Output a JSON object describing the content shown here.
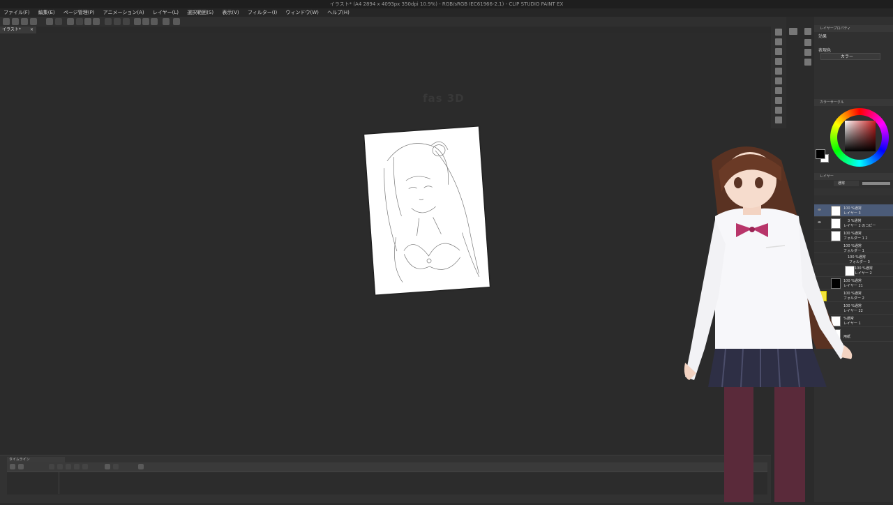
{
  "window": {
    "title": "イラスト* (A4 2894 x 4093px 350dpi 10.9%) - RGB/sRGB IEC61966-2.1) - CLIP STUDIO PAINT EX"
  },
  "menu": [
    "ファイル(F)",
    "編集(E)",
    "ページ管理(P)",
    "アニメーション(A)",
    "レイヤー(L)",
    "選択範囲(S)",
    "表示(V)",
    "フィルター(I)",
    "ウィンドウ(W)",
    "ヘルプ(H)"
  ],
  "document_tab": {
    "label": "イラスト*",
    "close": "×"
  },
  "canvas": {
    "ghost_text": "fas 3D"
  },
  "timeline": {
    "title": "タイムライン"
  },
  "panels": {
    "effects_header": "レイヤープロパティ",
    "effect_label": "効果",
    "expression_color_label": "表現色",
    "expression_color_value": "カラー",
    "color_wheel_header": "カラーサークル",
    "layers_header": "レイヤー",
    "blend_mode": "通常"
  },
  "layers": [
    {
      "mode": "100 %通常",
      "name": "レイヤー 3",
      "selected": true
    },
    {
      "mode": "3 %通常",
      "name": "レイヤー 2 のコピー",
      "selected": false
    },
    {
      "mode": "100 %通常",
      "name": "フォルダー 1 2",
      "selected": false
    },
    {
      "mode": "100 %通常",
      "name": "フォルダー 1",
      "selected": false
    },
    {
      "mode": "100 %通常",
      "name": "フォルダー 3",
      "selected": false
    },
    {
      "mode": "100 %通常",
      "name": "レイヤー 2",
      "selected": false
    },
    {
      "mode": "100 %通常",
      "name": "レイヤー 21",
      "selected": false
    },
    {
      "mode": "100 %通常",
      "name": "フォルダー 2",
      "selected": false
    },
    {
      "mode": "100 %通常",
      "name": "レイヤー 22",
      "selected": false
    },
    {
      "mode": "%通常",
      "name": "レイヤー 1",
      "selected": false
    },
    {
      "mode": "",
      "name": "用紙",
      "selected": false
    }
  ],
  "colors": {
    "main_color": "#000000",
    "sub_color": "#ffffff",
    "selected_layer": "#4b5b78"
  }
}
